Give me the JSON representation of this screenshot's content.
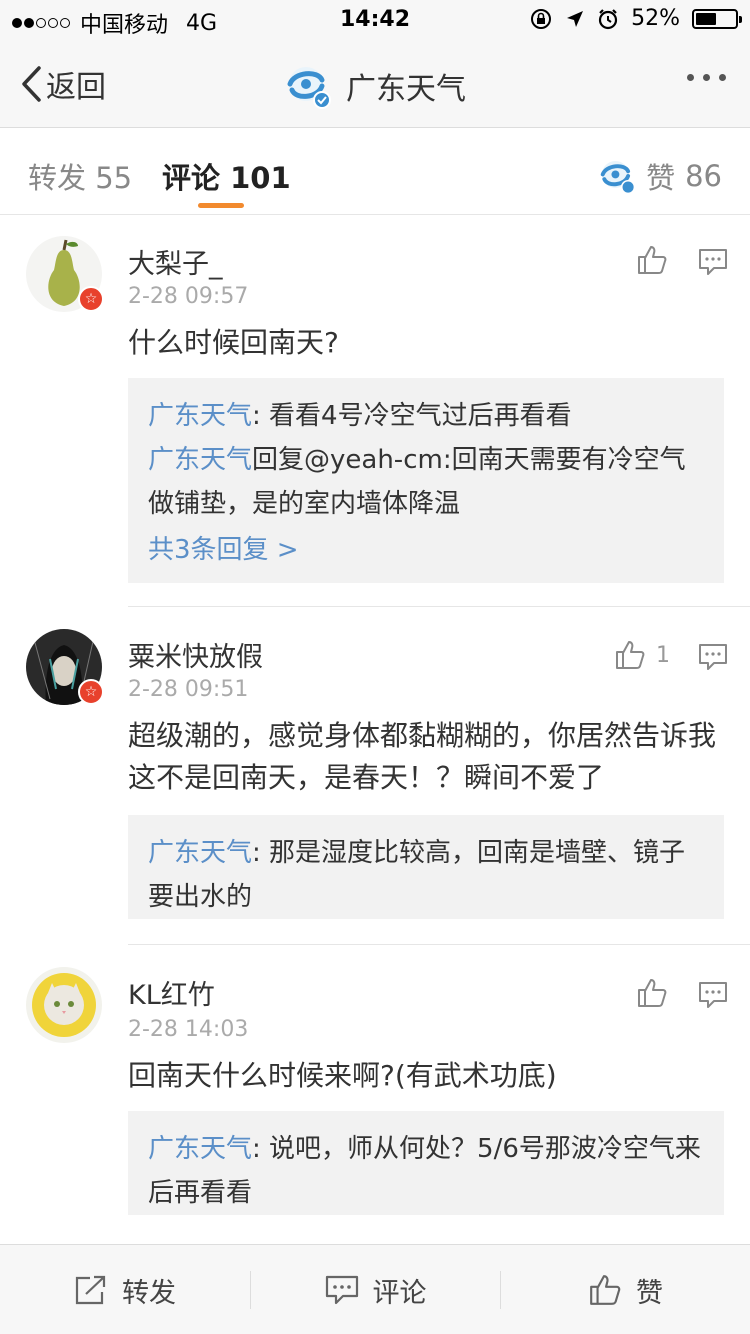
{
  "status_bar": {
    "carrier": "中国移动",
    "network": "4G",
    "time": "14:42",
    "battery": "52%",
    "battery_level": 0.52
  },
  "nav": {
    "back_label": "返回",
    "title": "广东天气"
  },
  "tabs": {
    "repost_label": "转发",
    "repost_count": "55",
    "comment_label": "评论",
    "comment_count": "101",
    "like_label": "赞",
    "like_count": "86"
  },
  "comments": [
    {
      "user": "大梨子_",
      "time": "2-28 09:57",
      "text": "什么时候回南天?",
      "likes": "",
      "replies": [
        {
          "author": "广东天气",
          "text": ": 看看4号冷空气过后再看看"
        },
        {
          "author": "广东天气",
          "text": "回复@yeah-cm:回南天需要有冷空气做铺垫，是的室内墙体降温"
        }
      ],
      "more_replies": "共3条回复 >"
    },
    {
      "user": "粟米快放假",
      "time": "2-28 09:51",
      "text": "超级潮的，感觉身体都黏糊糊的，你居然告诉我这不是回南天，是春天！？瞬间不爱了",
      "likes": "1",
      "replies": [
        {
          "author": "广东天气",
          "text": ": 那是湿度比较高，回南是墙壁、镜子要出水的"
        }
      ]
    },
    {
      "user": "KL红竹",
      "time": "2-28 14:03",
      "text": "回南天什么时候来啊?(有武术功底)",
      "likes": "",
      "replies": [
        {
          "author": "广东天气",
          "text": ": 说吧，师从何处？5/6号那波冷空气来后再看看"
        }
      ]
    }
  ],
  "bottom_bar": {
    "repost": "转发",
    "comment": "评论",
    "like": "赞"
  },
  "colors": {
    "accent": "#f28a2e",
    "link": "#5b8fc8",
    "badge": "#e8412c"
  }
}
